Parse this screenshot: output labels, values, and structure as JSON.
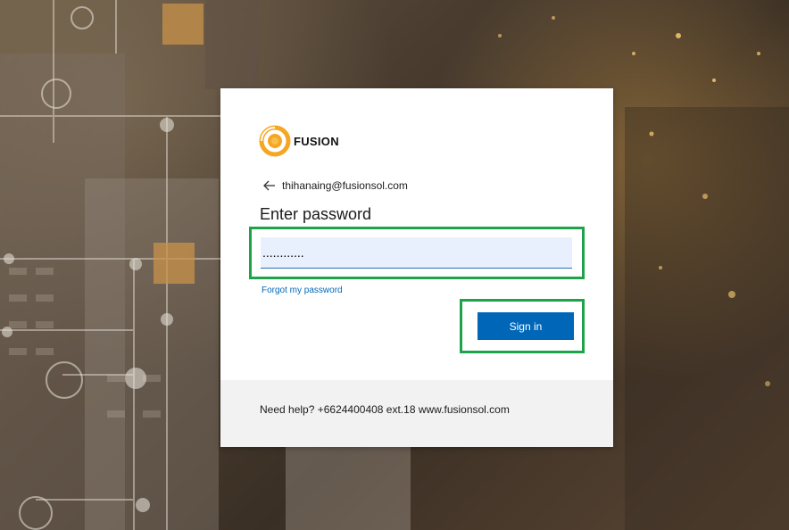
{
  "brand": {
    "name": "FUSION",
    "accent_color": "#f5a623"
  },
  "identity": {
    "email": "thihanaing@fusionsol.com",
    "back_icon": "arrow-left-icon"
  },
  "form": {
    "title": "Enter password",
    "password_value": "............",
    "forgot_link": "Forgot my password",
    "signin_label": "Sign in",
    "button_color": "#0067b8",
    "highlight_color": "#1fa34a"
  },
  "footer": {
    "help_text": "Need help? +6624400408 ext.18 www.fusionsol.com"
  }
}
